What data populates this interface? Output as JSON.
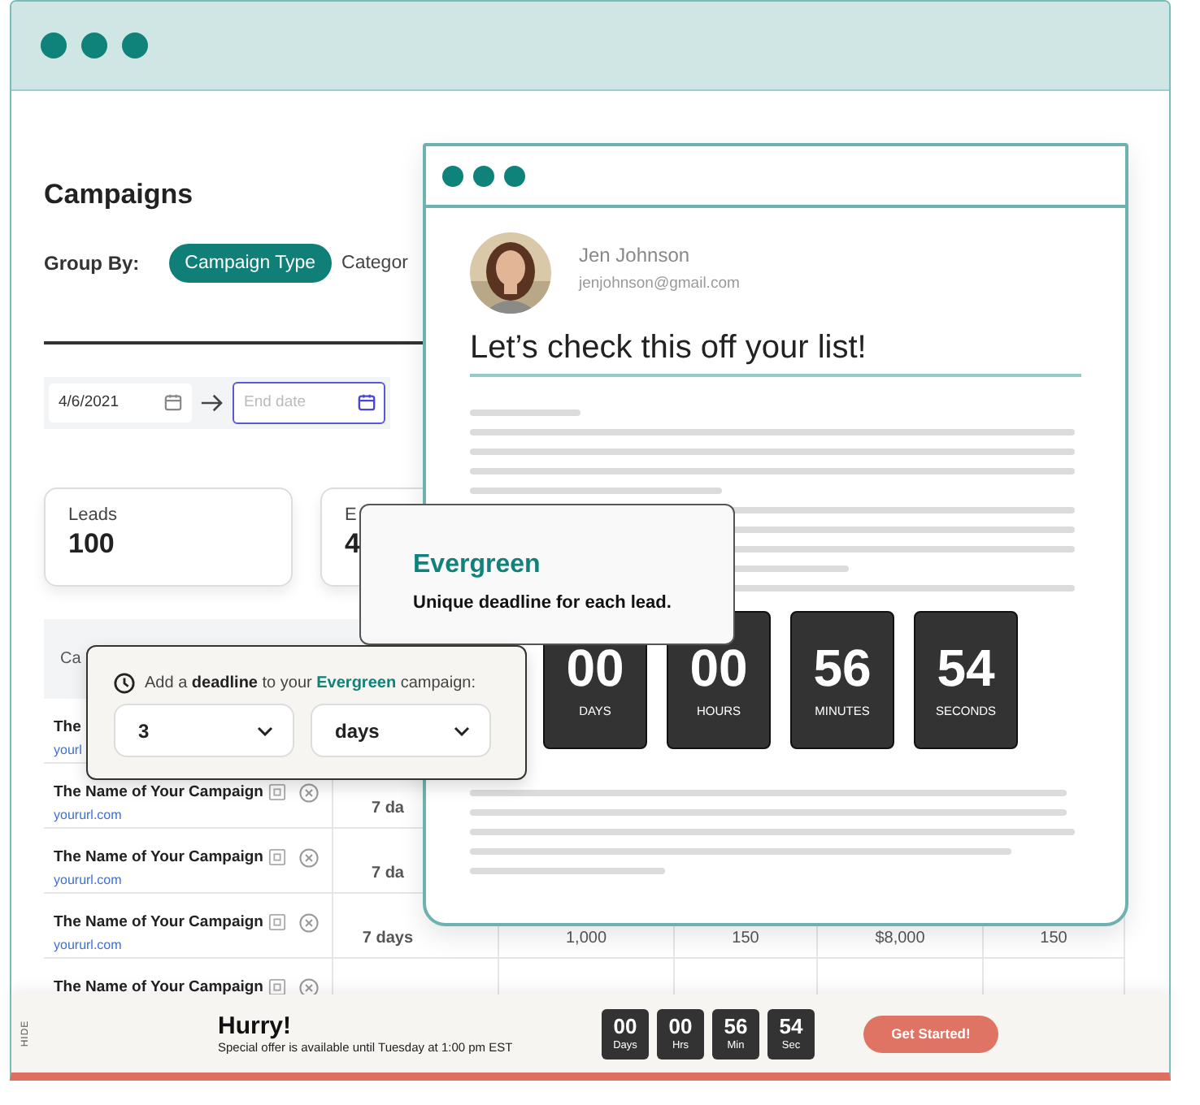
{
  "app_window": {
    "title": "Campaigns",
    "group_by": {
      "label": "Group By:",
      "options": [
        {
          "label": "Campaign Type",
          "selected": true
        },
        {
          "label": "Categor",
          "selected": false
        }
      ]
    },
    "date_range": {
      "start": "4/6/2021",
      "end_placeholder": "End date"
    },
    "stats": [
      {
        "label": "Leads",
        "value": "100"
      },
      {
        "label": "E",
        "value": "4"
      }
    ],
    "table": {
      "columns": [
        "Ca"
      ],
      "rows": [
        {
          "name": "The",
          "url": "yourl",
          "cells": []
        },
        {
          "name": "The Name of Your Campaign",
          "url": "yoururl.com",
          "cells": [
            "7 da"
          ]
        },
        {
          "name": "The Name of Your Campaign",
          "url": "yoururl.com",
          "cells": [
            "7 da"
          ]
        },
        {
          "name": "The Name of Your Campaign",
          "url": "yoururl.com",
          "cells": [
            "7 days",
            "1,000",
            "150",
            "$8,000",
            "150"
          ]
        },
        {
          "name": "The Name of Your Campaign",
          "cells": []
        }
      ]
    }
  },
  "email_window": {
    "sender": {
      "name": "Jen Johnson",
      "email": "jenjohnson@gmail.com"
    },
    "heading": "Let’s check this off your list!",
    "countdown": [
      {
        "value": "00",
        "unit": "DAYS"
      },
      {
        "value": "00",
        "unit": "HOURS"
      },
      {
        "value": "56",
        "unit": "MINUTES"
      },
      {
        "value": "54",
        "unit": "SECONDS"
      }
    ]
  },
  "tooltip": {
    "title": "Evergreen",
    "text": "Unique deadline for each lead."
  },
  "deadline_popover": {
    "prompt": [
      {
        "text": "Add a ",
        "kind": "plain"
      },
      {
        "text": "deadline",
        "kind": "bold"
      },
      {
        "text": " to your ",
        "kind": "plain"
      },
      {
        "text": "Evergreen",
        "kind": "accent"
      },
      {
        "text": " campaign:",
        "kind": "plain"
      }
    ],
    "amount": "3",
    "unit": "days"
  },
  "promo_bar": {
    "hide": "HIDE",
    "title": "Hurry!",
    "text": "Special offer is available until Tuesday at 1:00 pm EST",
    "countdown": [
      {
        "value": "00",
        "unit": "Days"
      },
      {
        "value": "00",
        "unit": "Hrs"
      },
      {
        "value": "56",
        "unit": "Min"
      },
      {
        "value": "54",
        "unit": "Sec"
      }
    ],
    "button": "Get Started!"
  }
}
